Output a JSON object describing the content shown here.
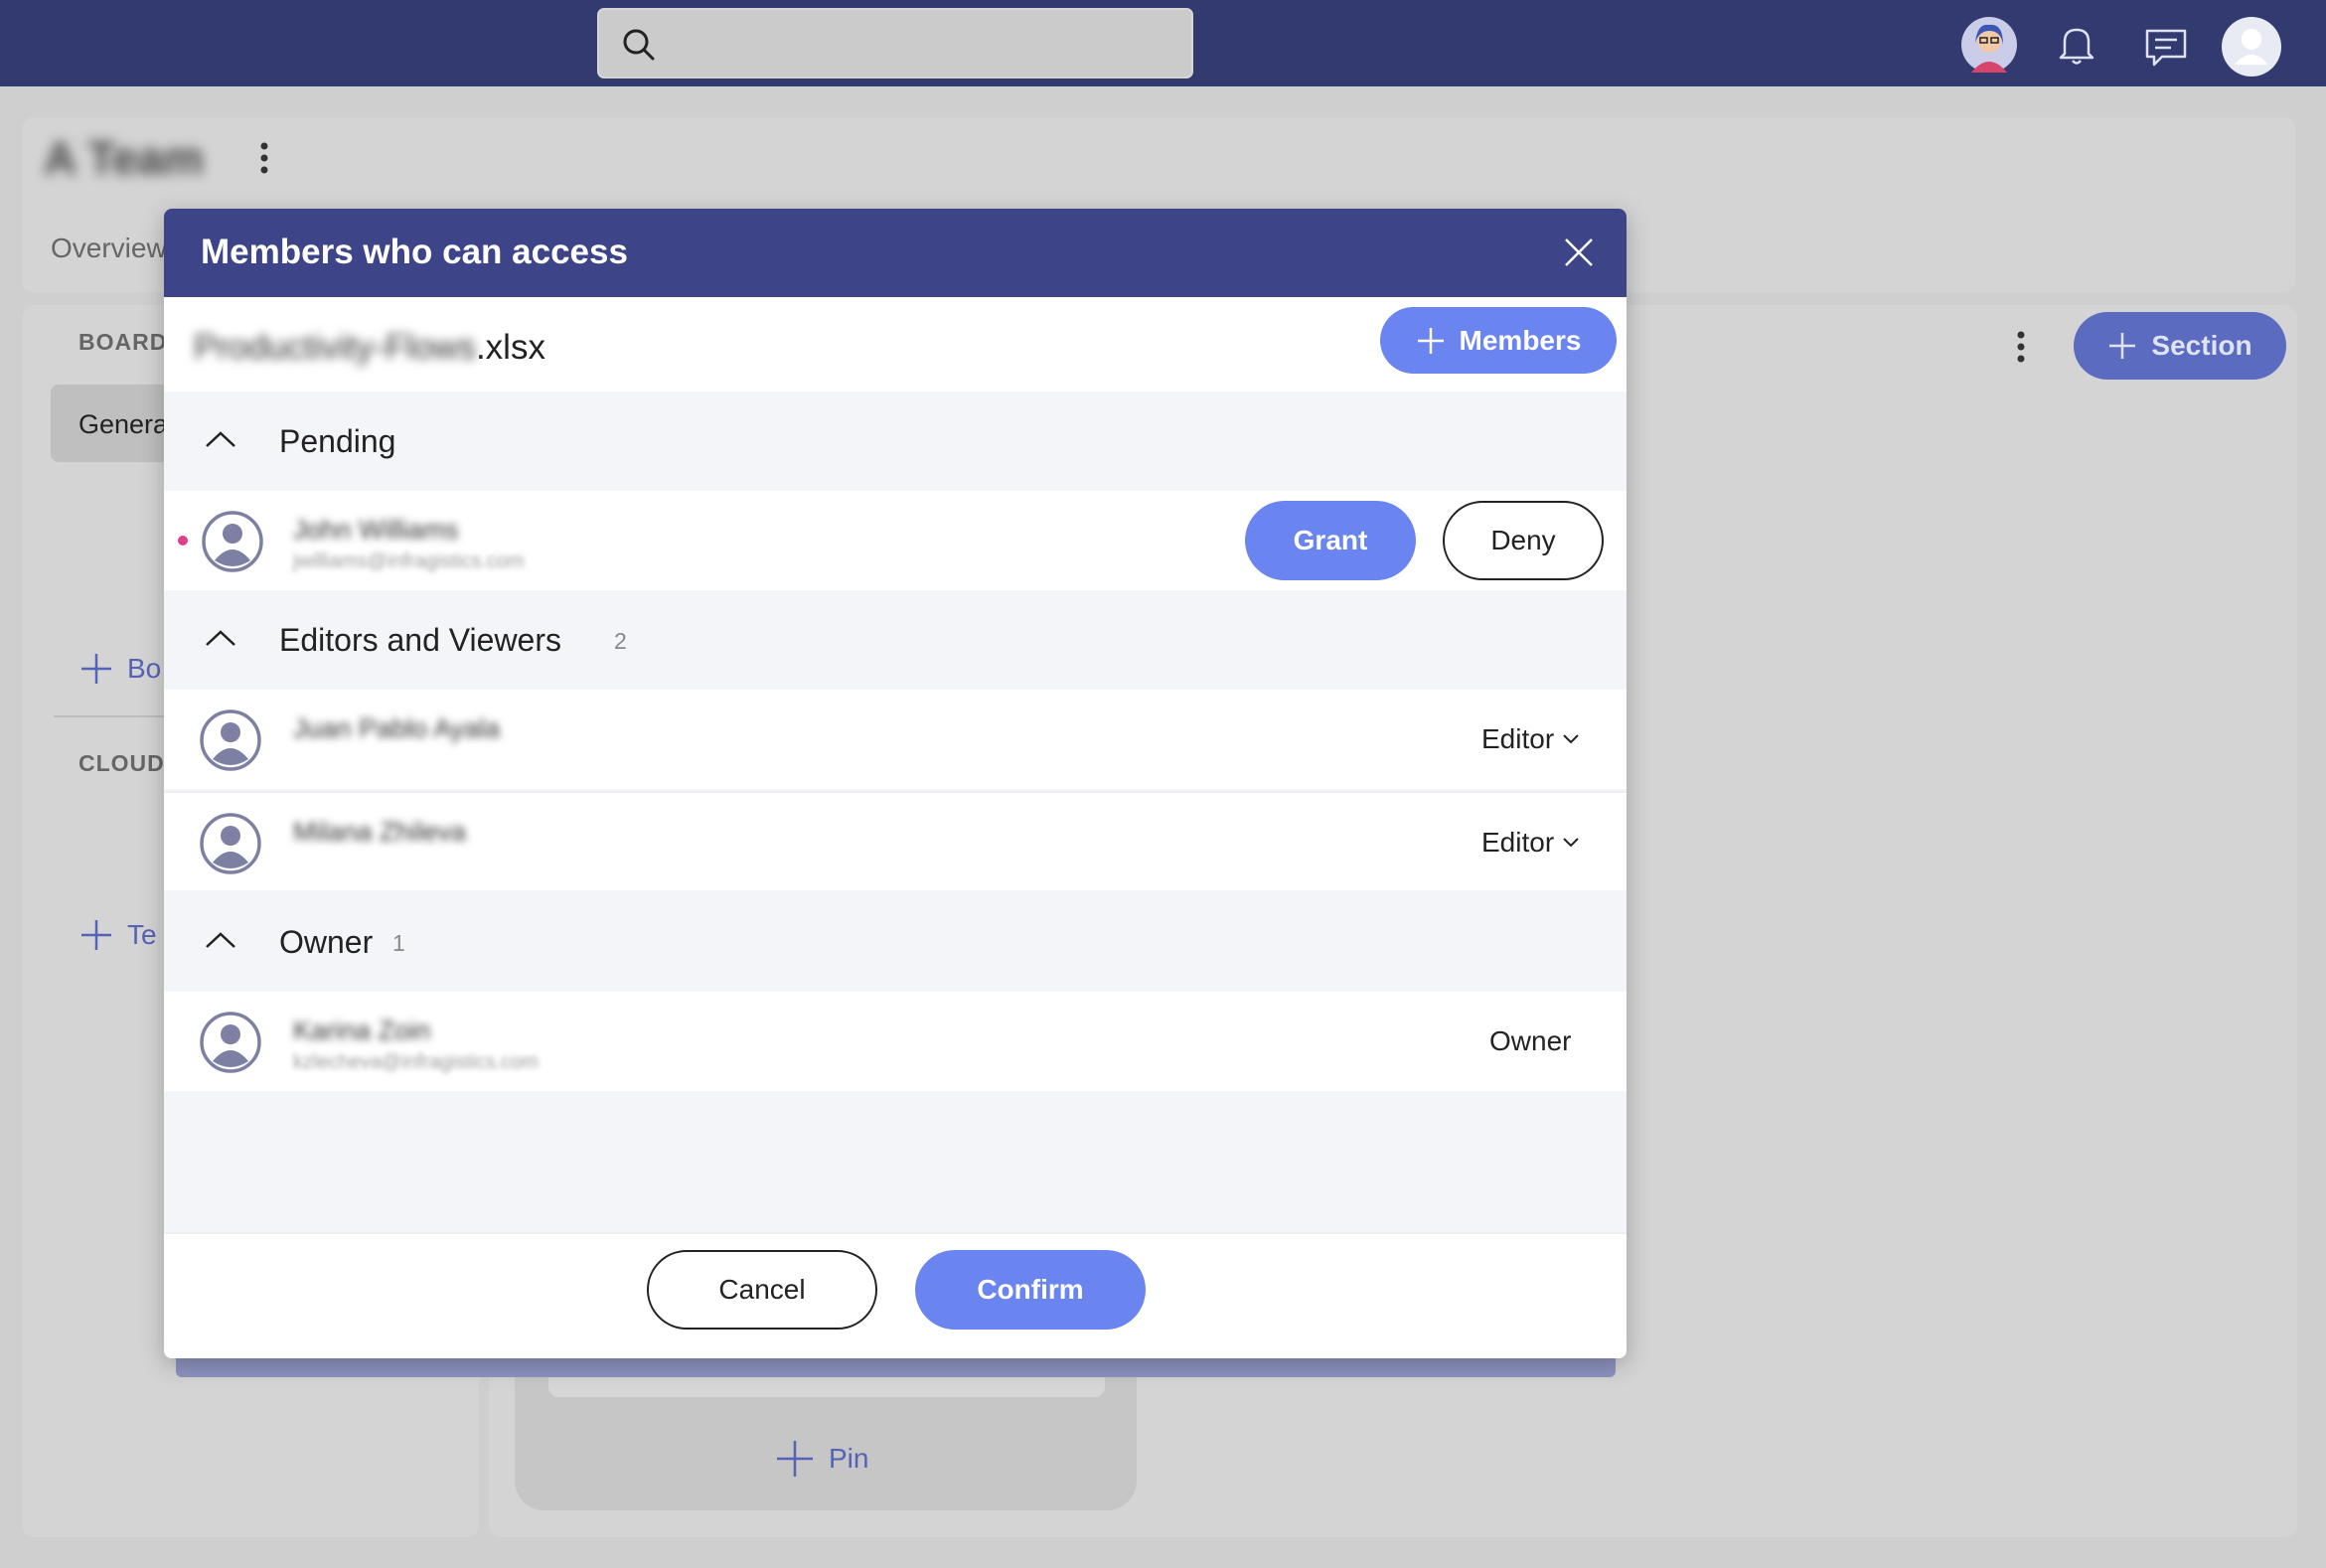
{
  "colors": {
    "topbar": "#333a70",
    "modal_header": "#3d4588",
    "accent": "#6a84f0",
    "pending_dot": "#e0408a"
  },
  "topbar": {
    "search_placeholder": "",
    "icons": [
      "search-icon",
      "user-avatar-icon",
      "bell-icon",
      "message-icon",
      "profile-icon"
    ]
  },
  "background": {
    "team_name": "A Team",
    "tab_overview": "Overview",
    "boards_label": "BOARDS",
    "general_item": "Genera",
    "add_board": "Bo",
    "cloud_label": "CLOUD S",
    "add_team": "Te",
    "section_button": "Section",
    "pin_button": "Pin"
  },
  "modal": {
    "title": "Members who can access",
    "file_name_blurred": "Productivity-Flows",
    "file_ext": ".xlsx",
    "members_button": "Members",
    "groups": {
      "pending": {
        "title": "Pending",
        "count": "",
        "members": [
          {
            "name": "John Williams",
            "email": "jwilliams@infragistics.com",
            "actions": [
              "Grant",
              "Deny"
            ]
          }
        ]
      },
      "editors": {
        "title": "Editors and Viewers",
        "count": "2",
        "members": [
          {
            "name": "Juan Pablo Ayala",
            "email": "",
            "role": "Editor"
          },
          {
            "name": "Milana Zhileva",
            "email": "",
            "role": "Editor"
          }
        ]
      },
      "owner": {
        "title": "Owner",
        "count": "1",
        "members": [
          {
            "name": "Karina Zoin",
            "email": "kzlecheva@infragistics.com",
            "role": "Owner"
          }
        ]
      }
    },
    "footer": {
      "cancel": "Cancel",
      "confirm": "Confirm"
    }
  }
}
